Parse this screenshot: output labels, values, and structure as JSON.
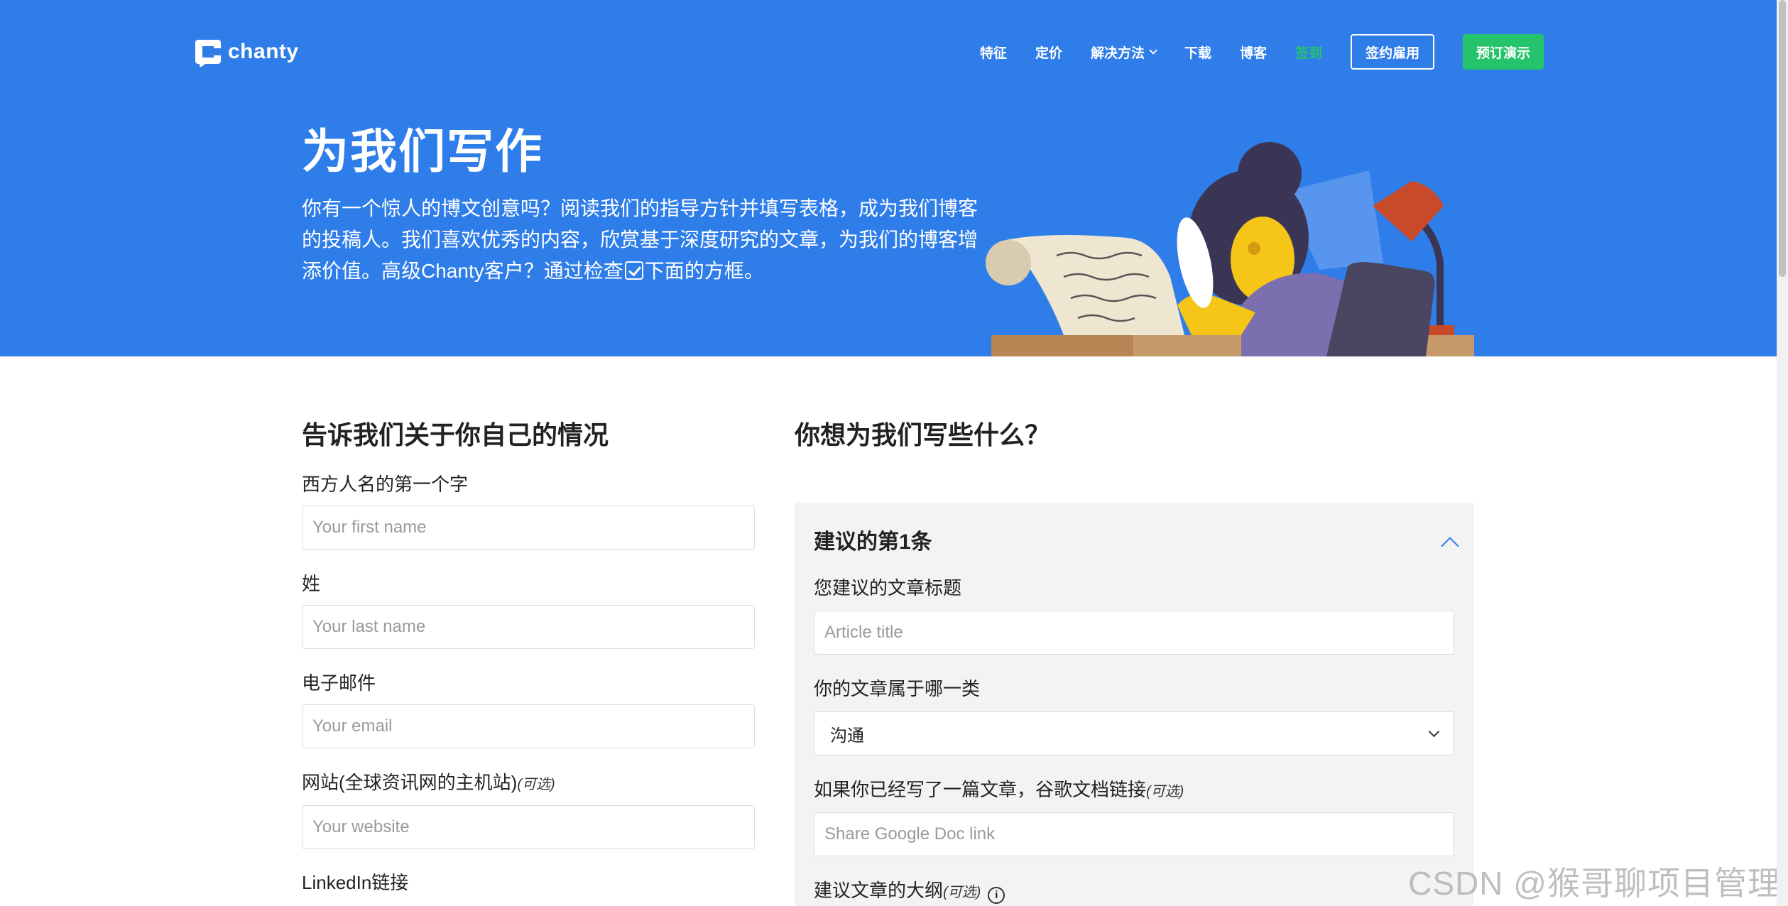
{
  "header": {
    "logo_text": "chanty",
    "nav": [
      {
        "label": "特征"
      },
      {
        "label": "定价"
      },
      {
        "label": "解决方法"
      },
      {
        "label": "下载"
      },
      {
        "label": "博客"
      },
      {
        "label": "签到"
      }
    ],
    "signup_label": "签约雇用",
    "demo_label": "预订演示"
  },
  "hero": {
    "title": "为我们写作",
    "desc_before": "你有一个惊人的博文创意吗？阅读我们的指导方针并填写表格，成为我们博客的投稿人。我们喜欢优秀的内容，欣赏基于深度研究的文章，为我们的博客增添价值。高级Chanty客户？通过检查",
    "desc_after": "下面的方框。"
  },
  "about": {
    "title": "告诉我们关于你自己的情况",
    "first_name_label": "西方人名的第一个字",
    "first_name_placeholder": "Your first name",
    "last_name_label": "姓",
    "last_name_placeholder": "Your last name",
    "email_label": "电子邮件",
    "email_placeholder": "Your email",
    "website_label": "网站(全球资讯网的主机站)",
    "website_optional": "(可选)",
    "website_placeholder": "Your website",
    "linkedin_label": "LinkedIn链接"
  },
  "write": {
    "title": "你想为我们写些什么？",
    "suggestion_title": "建议的第1条",
    "article_title_label": "您建议的文章标题",
    "article_title_placeholder": "Article title",
    "category_label": "你的文章属于哪一类",
    "category_value": "沟通",
    "doc_label": "如果你已经写了一篇文章，谷歌文档链接",
    "doc_optional": "(可选)",
    "doc_placeholder": "Share Google Doc link",
    "outline_label": "建议文章的大纲",
    "outline_optional": "(可选)",
    "info_glyph": "i"
  },
  "watermark": "CSDN @猴哥聊项目管理",
  "colors": {
    "hero_bg": "#2f7de9",
    "accent_green": "#25c46c",
    "panel_bg": "#f3f3f3"
  }
}
